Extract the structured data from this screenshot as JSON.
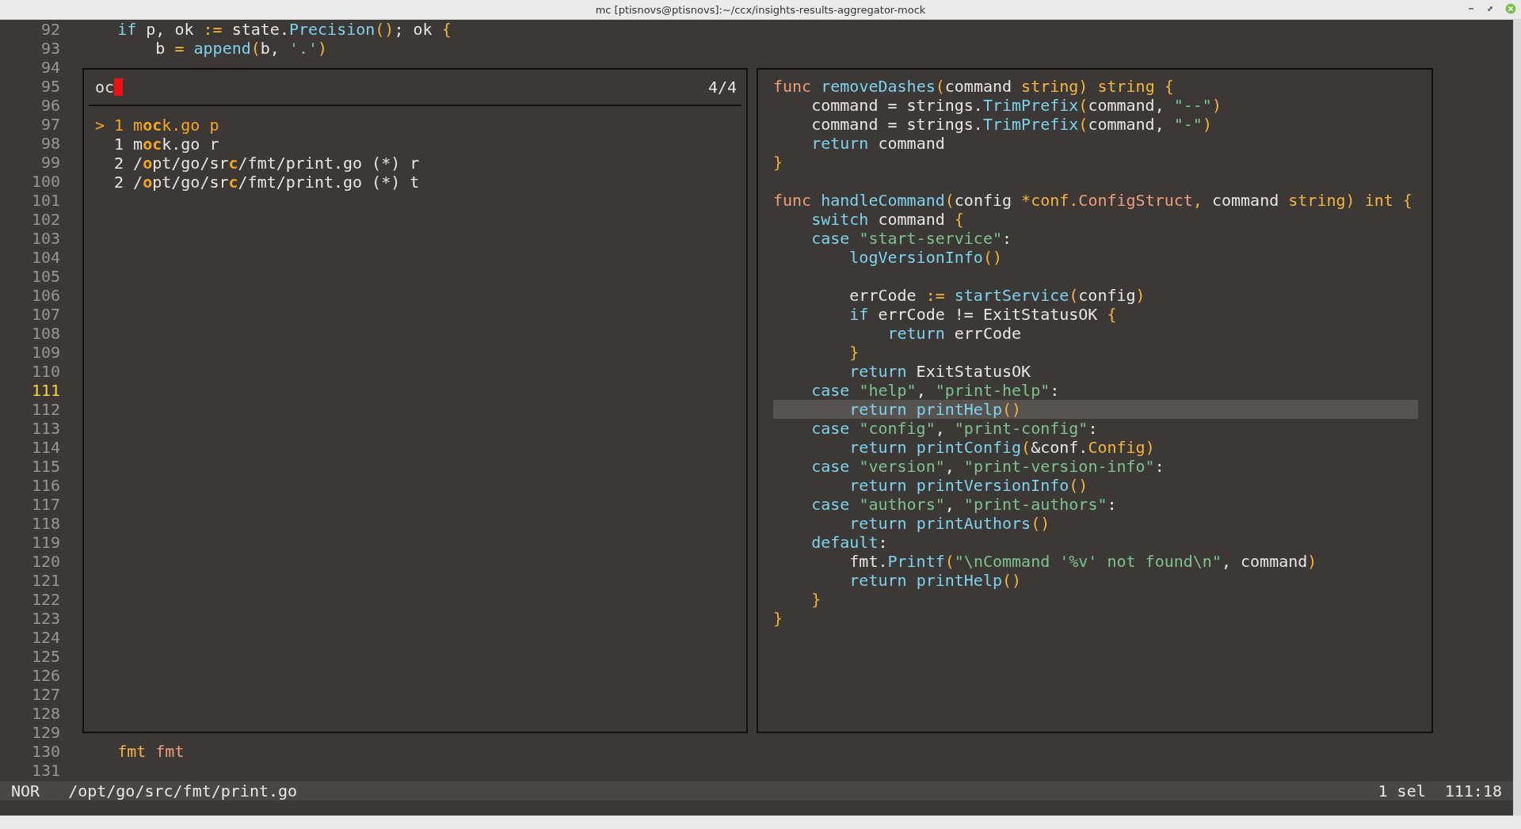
{
  "window": {
    "title": "mc [ptisnovs@ptisnovs]:~/ccx/insights-results-aggregator-mock"
  },
  "editor": {
    "lines": [
      {
        "number": "92",
        "current": false,
        "tokens": [
          {
            "kind": "control",
            "text": "    if"
          },
          {
            "kind": "plain",
            "text": " p, ok "
          },
          {
            "kind": "op",
            "text": ":="
          },
          {
            "kind": "plain",
            "text": " state."
          },
          {
            "kind": "func",
            "text": "Precision"
          },
          {
            "kind": "punct",
            "text": "()"
          },
          {
            "kind": "plain",
            "text": "; ok "
          },
          {
            "kind": "punct",
            "text": "{"
          }
        ]
      },
      {
        "number": "93",
        "current": false,
        "tokens": [
          {
            "kind": "plain",
            "text": "        b "
          },
          {
            "kind": "op",
            "text": "= "
          },
          {
            "kind": "func",
            "text": "append"
          },
          {
            "kind": "punct",
            "text": "("
          },
          {
            "kind": "plain",
            "text": "b, "
          },
          {
            "kind": "string",
            "text": "'.'"
          },
          {
            "kind": "punct",
            "text": ")"
          }
        ]
      },
      {
        "number": "94",
        "current": false
      },
      {
        "number": "95",
        "current": false
      },
      {
        "number": "96",
        "current": false
      },
      {
        "number": "97",
        "current": false
      },
      {
        "number": "98",
        "current": false
      },
      {
        "number": "99",
        "current": false
      },
      {
        "number": "100",
        "current": false
      },
      {
        "number": "101",
        "current": false
      },
      {
        "number": "102",
        "current": false
      },
      {
        "number": "103",
        "current": false
      },
      {
        "number": "104",
        "current": false
      },
      {
        "number": "105",
        "current": false
      },
      {
        "number": "106",
        "current": false
      },
      {
        "number": "107",
        "current": false
      },
      {
        "number": "108",
        "current": false
      },
      {
        "number": "109",
        "current": false
      },
      {
        "number": "110",
        "current": false
      },
      {
        "number": "111",
        "current": true
      },
      {
        "number": "112",
        "current": false
      },
      {
        "number": "113",
        "current": false
      },
      {
        "number": "114",
        "current": false
      },
      {
        "number": "115",
        "current": false
      },
      {
        "number": "116",
        "current": false
      },
      {
        "number": "117",
        "current": false
      },
      {
        "number": "118",
        "current": false
      },
      {
        "number": "119",
        "current": false
      },
      {
        "number": "120",
        "current": false
      },
      {
        "number": "121",
        "current": false
      },
      {
        "number": "122",
        "current": false
      },
      {
        "number": "123",
        "current": false
      },
      {
        "number": "124",
        "current": false
      },
      {
        "number": "125",
        "current": false
      },
      {
        "number": "126",
        "current": false
      },
      {
        "number": "127",
        "current": false
      },
      {
        "number": "128",
        "current": false
      },
      {
        "number": "129",
        "current": false
      },
      {
        "number": "130",
        "current": false,
        "tokens": [
          {
            "kind": "type",
            "text": "    fmt "
          },
          {
            "kind": "keyword",
            "text": "fmt"
          }
        ]
      },
      {
        "number": "131",
        "current": false
      }
    ]
  },
  "picker": {
    "query": "oc",
    "count": "4/4",
    "marker": ">",
    "items": [
      {
        "selected": true,
        "segments": [
          {
            "text": "1 m",
            "match": false
          },
          {
            "text": "oc",
            "match": true
          },
          {
            "text": "k.go p",
            "match": false
          }
        ]
      },
      {
        "selected": false,
        "segments": [
          {
            "text": "1 m",
            "match": false
          },
          {
            "text": "oc",
            "match": true
          },
          {
            "text": "k.go r",
            "match": false
          }
        ]
      },
      {
        "selected": false,
        "segments": [
          {
            "text": "2 /",
            "match": false
          },
          {
            "text": "o",
            "match": true
          },
          {
            "text": "pt/go/sr",
            "match": false
          },
          {
            "text": "c",
            "match": true
          },
          {
            "text": "/fmt/print.go (*) r",
            "match": false
          }
        ]
      },
      {
        "selected": false,
        "segments": [
          {
            "text": "2 /",
            "match": false
          },
          {
            "text": "o",
            "match": true
          },
          {
            "text": "pt/go/sr",
            "match": false
          },
          {
            "text": "c",
            "match": true
          },
          {
            "text": "/fmt/print.go (*) t",
            "match": false
          }
        ]
      }
    ]
  },
  "preview": {
    "lines": [
      {
        "highlighted": false,
        "tokens": [
          {
            "kind": "keyword",
            "text": "func "
          },
          {
            "kind": "func",
            "text": "removeDashes"
          },
          {
            "kind": "punct",
            "text": "("
          },
          {
            "kind": "plain",
            "text": "command "
          },
          {
            "kind": "type",
            "text": "string"
          },
          {
            "kind": "punct",
            "text": ") "
          },
          {
            "kind": "type",
            "text": "string "
          },
          {
            "kind": "punct",
            "text": "{"
          }
        ]
      },
      {
        "highlighted": false,
        "tokens": [
          {
            "kind": "plain",
            "text": "    command = strings."
          },
          {
            "kind": "func",
            "text": "TrimPrefix"
          },
          {
            "kind": "punct",
            "text": "("
          },
          {
            "kind": "plain",
            "text": "command, "
          },
          {
            "kind": "string",
            "text": "\"--\""
          },
          {
            "kind": "punct",
            "text": ")"
          }
        ]
      },
      {
        "highlighted": false,
        "tokens": [
          {
            "kind": "plain",
            "text": "    command = strings."
          },
          {
            "kind": "func",
            "text": "TrimPrefix"
          },
          {
            "kind": "punct",
            "text": "("
          },
          {
            "kind": "plain",
            "text": "command, "
          },
          {
            "kind": "string",
            "text": "\"-\""
          },
          {
            "kind": "punct",
            "text": ")"
          }
        ]
      },
      {
        "highlighted": false,
        "tokens": [
          {
            "kind": "control",
            "text": "    return"
          },
          {
            "kind": "plain",
            "text": " command"
          }
        ]
      },
      {
        "highlighted": false,
        "tokens": [
          {
            "kind": "punct",
            "text": "}"
          }
        ]
      },
      {
        "highlighted": false
      },
      {
        "highlighted": false,
        "tokens": [
          {
            "kind": "keyword",
            "text": "func "
          },
          {
            "kind": "func",
            "text": "handleCommand"
          },
          {
            "kind": "punct",
            "text": "("
          },
          {
            "kind": "plain",
            "text": "config "
          },
          {
            "kind": "type",
            "text": "*conf."
          },
          {
            "kind": "typename",
            "text": "ConfigStruct"
          },
          {
            "kind": "punct",
            "text": ","
          },
          {
            "kind": "plain",
            "text": " command "
          },
          {
            "kind": "type",
            "text": "string"
          },
          {
            "kind": "punct",
            "text": ") "
          },
          {
            "kind": "type",
            "text": "int "
          },
          {
            "kind": "punct",
            "text": "{"
          }
        ]
      },
      {
        "highlighted": false,
        "tokens": [
          {
            "kind": "control",
            "text": "    switch"
          },
          {
            "kind": "plain",
            "text": " command "
          },
          {
            "kind": "punct",
            "text": "{"
          }
        ]
      },
      {
        "highlighted": false,
        "tokens": [
          {
            "kind": "control",
            "text": "    case "
          },
          {
            "kind": "string",
            "text": "\"start-service\""
          },
          {
            "kind": "plain",
            "text": ":"
          }
        ]
      },
      {
        "highlighted": false,
        "tokens": [
          {
            "kind": "func",
            "text": "        logVersionInfo"
          },
          {
            "kind": "punct",
            "text": "()"
          }
        ]
      },
      {
        "highlighted": false
      },
      {
        "highlighted": false,
        "tokens": [
          {
            "kind": "plain",
            "text": "        errCode "
          },
          {
            "kind": "op",
            "text": ":= "
          },
          {
            "kind": "func",
            "text": "startService"
          },
          {
            "kind": "punct",
            "text": "("
          },
          {
            "kind": "plain",
            "text": "config"
          },
          {
            "kind": "punct",
            "text": ")"
          }
        ]
      },
      {
        "highlighted": false,
        "tokens": [
          {
            "kind": "control",
            "text": "        if"
          },
          {
            "kind": "plain",
            "text": " errCode != ExitStatusOK "
          },
          {
            "kind": "punct",
            "text": "{"
          }
        ]
      },
      {
        "highlighted": false,
        "tokens": [
          {
            "kind": "control",
            "text": "            return"
          },
          {
            "kind": "plain",
            "text": " errCode"
          }
        ]
      },
      {
        "highlighted": false,
        "tokens": [
          {
            "kind": "punct",
            "text": "        }"
          }
        ]
      },
      {
        "highlighted": false,
        "tokens": [
          {
            "kind": "control",
            "text": "        return"
          },
          {
            "kind": "plain",
            "text": " ExitStatusOK"
          }
        ]
      },
      {
        "highlighted": false,
        "tokens": [
          {
            "kind": "control",
            "text": "    case "
          },
          {
            "kind": "string",
            "text": "\"help\""
          },
          {
            "kind": "plain",
            "text": ", "
          },
          {
            "kind": "string",
            "text": "\"print-help\""
          },
          {
            "kind": "plain",
            "text": ":"
          }
        ]
      },
      {
        "highlighted": true,
        "tokens": [
          {
            "kind": "control",
            "text": "        return "
          },
          {
            "kind": "func",
            "text": "printHelp"
          },
          {
            "kind": "punct",
            "text": "()"
          }
        ]
      },
      {
        "highlighted": false,
        "tokens": [
          {
            "kind": "control",
            "text": "    case "
          },
          {
            "kind": "string",
            "text": "\"config\""
          },
          {
            "kind": "plain",
            "text": ", "
          },
          {
            "kind": "string",
            "text": "\"print-config\""
          },
          {
            "kind": "plain",
            "text": ":"
          }
        ]
      },
      {
        "highlighted": false,
        "tokens": [
          {
            "kind": "control",
            "text": "        return "
          },
          {
            "kind": "func",
            "text": "printConfig"
          },
          {
            "kind": "punct",
            "text": "("
          },
          {
            "kind": "plain",
            "text": "&conf."
          },
          {
            "kind": "type",
            "text": "Config"
          },
          {
            "kind": "punct",
            "text": ")"
          }
        ]
      },
      {
        "highlighted": false,
        "tokens": [
          {
            "kind": "control",
            "text": "    case "
          },
          {
            "kind": "string",
            "text": "\"version\""
          },
          {
            "kind": "plain",
            "text": ", "
          },
          {
            "kind": "string",
            "text": "\"print-version-info\""
          },
          {
            "kind": "plain",
            "text": ":"
          }
        ]
      },
      {
        "highlighted": false,
        "tokens": [
          {
            "kind": "control",
            "text": "        return "
          },
          {
            "kind": "func",
            "text": "printVersionInfo"
          },
          {
            "kind": "punct",
            "text": "()"
          }
        ]
      },
      {
        "highlighted": false,
        "tokens": [
          {
            "kind": "control",
            "text": "    case "
          },
          {
            "kind": "string",
            "text": "\"authors\""
          },
          {
            "kind": "plain",
            "text": ", "
          },
          {
            "kind": "string",
            "text": "\"print-authors\""
          },
          {
            "kind": "plain",
            "text": ":"
          }
        ]
      },
      {
        "highlighted": false,
        "tokens": [
          {
            "kind": "control",
            "text": "        return "
          },
          {
            "kind": "func",
            "text": "printAuthors"
          },
          {
            "kind": "punct",
            "text": "()"
          }
        ]
      },
      {
        "highlighted": false,
        "tokens": [
          {
            "kind": "control",
            "text": "    default"
          },
          {
            "kind": "plain",
            "text": ":"
          }
        ]
      },
      {
        "highlighted": false,
        "tokens": [
          {
            "kind": "plain",
            "text": "        fmt."
          },
          {
            "kind": "func",
            "text": "Printf"
          },
          {
            "kind": "punct",
            "text": "("
          },
          {
            "kind": "string",
            "text": "\"\\nCommand '%v' not found\\n\""
          },
          {
            "kind": "plain",
            "text": ", command"
          },
          {
            "kind": "punct",
            "text": ")"
          }
        ]
      },
      {
        "highlighted": false,
        "tokens": [
          {
            "kind": "control",
            "text": "        return "
          },
          {
            "kind": "func",
            "text": "printHelp"
          },
          {
            "kind": "punct",
            "text": "()"
          }
        ]
      },
      {
        "highlighted": false,
        "tokens": [
          {
            "kind": "punct",
            "text": "    }"
          }
        ]
      },
      {
        "highlighted": false,
        "tokens": [
          {
            "kind": "punct",
            "text": "}"
          }
        ]
      }
    ]
  },
  "status_bar": {
    "mode": "NOR",
    "file": "/opt/go/src/fmt/print.go",
    "selections": "1 sel",
    "position": "111:18"
  }
}
